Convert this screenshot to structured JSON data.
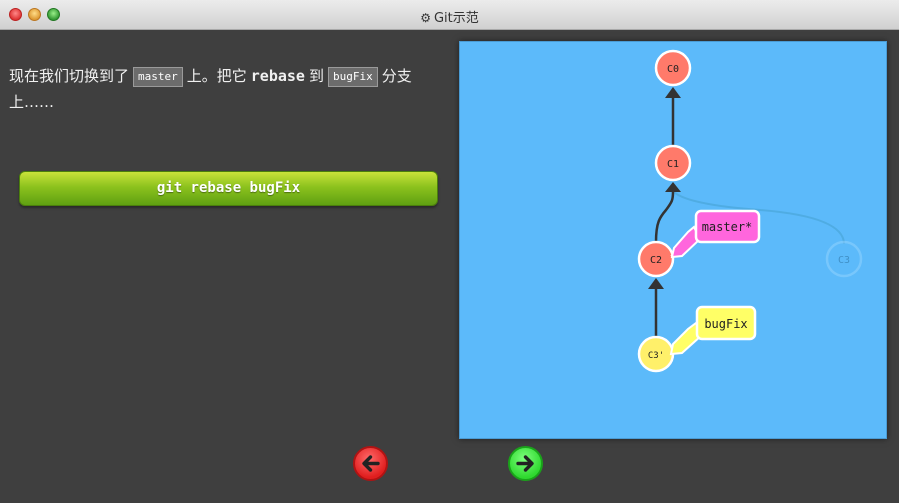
{
  "window": {
    "title": "Git示范",
    "title_icon": "gear-icon"
  },
  "instructions": {
    "part1": "现在我们切换到了",
    "branch1": "master",
    "part2": "上。把它",
    "cmd": "rebase",
    "part3": "到",
    "branch2": "bugFix",
    "part4": "分支上……"
  },
  "command_button": {
    "label": "git rebase bugFix"
  },
  "graph": {
    "commits": [
      {
        "id": "C0",
        "color": "#ff7a6a"
      },
      {
        "id": "C1",
        "color": "#ff7a6a"
      },
      {
        "id": "C2",
        "color": "#ff7a6a"
      },
      {
        "id": "C3",
        "color": "#5cbafa",
        "faded": true
      },
      {
        "id": "C3'",
        "color": "#fff06a"
      }
    ],
    "branches": [
      {
        "name": "master*",
        "color": "#ff66dd"
      },
      {
        "name": "bugFix",
        "color": "#ffff66"
      }
    ]
  },
  "nav": {
    "back": "back-arrow-icon",
    "forward": "forward-arrow-icon",
    "back_color": "#e62a2a",
    "forward_color": "#35d935"
  }
}
